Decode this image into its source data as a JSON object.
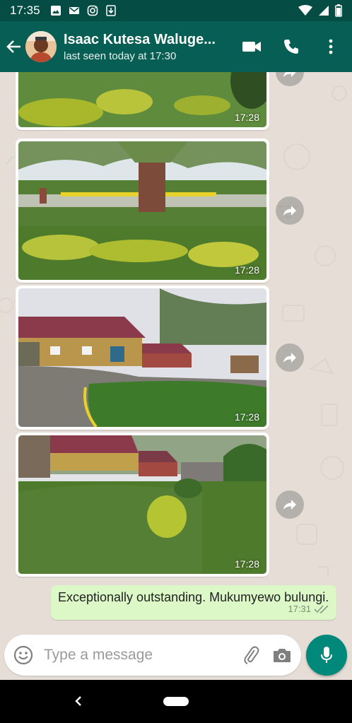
{
  "status_bar": {
    "time": "17:35",
    "icons_left": [
      "image-icon",
      "gmail-icon",
      "instagram-icon",
      "download-icon"
    ],
    "icons_right": [
      "wifi-icon",
      "signal-icon",
      "battery-icon"
    ]
  },
  "header": {
    "contact_name": "Isaac Kutesa Waluge...",
    "contact_status": "last seen today at 17:30",
    "actions": [
      "video-call-icon",
      "voice-call-icon",
      "more-options-icon"
    ]
  },
  "messages": [
    {
      "type": "image",
      "time": "17:28",
      "scene": "lawn-hedge"
    },
    {
      "type": "image",
      "time": "17:28",
      "scene": "tree-lawn"
    },
    {
      "type": "image",
      "time": "17:28",
      "scene": "house-driveway"
    },
    {
      "type": "image",
      "time": "17:28",
      "scene": "garden-houses"
    },
    {
      "type": "text",
      "direction": "outgoing",
      "text": "Exceptionally outstanding. Mukumyewo bulungi.",
      "time": "17:31",
      "ticks": "double-check-icon"
    }
  ],
  "input": {
    "placeholder": "Type a message",
    "value": ""
  },
  "colors": {
    "header": "#075e54",
    "status_bar": "#054d44",
    "outgoing_bubble": "#dcf8c6",
    "accent": "#00897b",
    "chat_bg": "#e5ddd5"
  }
}
